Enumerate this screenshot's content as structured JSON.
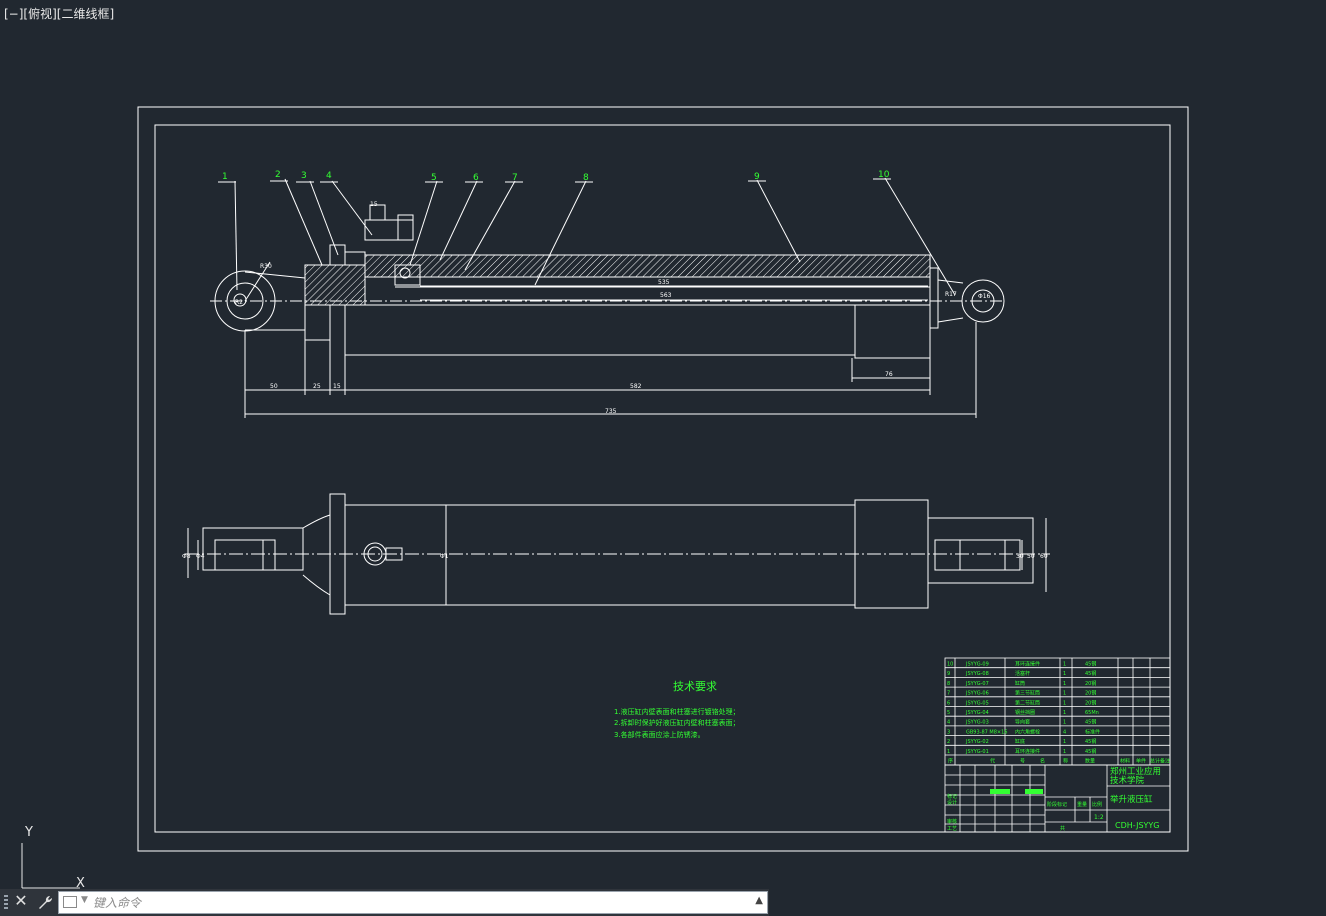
{
  "viewport": {
    "label": "[−][俯视][二维线框]"
  },
  "balloons": [
    "1",
    "2",
    "3",
    "4",
    "5",
    "6",
    "7",
    "8",
    "9",
    "10"
  ],
  "dimensions": {
    "small_top": "15",
    "r1": "R30",
    "r2": "R2",
    "d535": "535",
    "d563": "563",
    "d50": "50",
    "d25": "25",
    "d15": "15",
    "d582": "582",
    "d76": "76",
    "d735": "735",
    "r_right": "R17",
    "d16": "Φ16",
    "lower_left": "Φ8",
    "lower_left2": "Φ4",
    "lower_mid": "Φ1",
    "lower_right1": "30",
    "lower_right2": "50",
    "lower_right3": "60"
  },
  "tech": {
    "title": "技术要求",
    "lines": [
      "1.液压缸内壁表面和柱塞进行镀铬处理；",
      "2.拆卸时保护好液压缸内壁和柱塞表面；",
      "3.各部件表面应涂上防锈漆。"
    ]
  },
  "bom_rows": [
    {
      "no": "10",
      "code": "JSYYG-09",
      "name": "耳环连接件",
      "qty": "1",
      "mat": "45钢"
    },
    {
      "no": "9",
      "code": "JSYYG-08",
      "name": "活塞杆",
      "qty": "1",
      "mat": "45钢"
    },
    {
      "no": "8",
      "code": "JSYYG-07",
      "name": "缸筒",
      "qty": "1",
      "mat": "20钢"
    },
    {
      "no": "7",
      "code": "JSYYG-06",
      "name": "第三节缸筒",
      "qty": "1",
      "mat": "20钢"
    },
    {
      "no": "6",
      "code": "JSYYG-05",
      "name": "第二节缸筒",
      "qty": "1",
      "mat": "20钢"
    },
    {
      "no": "5",
      "code": "JSYYG-04",
      "name": "钢丝挡圈",
      "qty": "1",
      "mat": "65Mn"
    },
    {
      "no": "4",
      "code": "JSYYG-03",
      "name": "导向套",
      "qty": "1",
      "mat": "45钢"
    },
    {
      "no": "3",
      "code": "GB93-87 M8×16",
      "name": "内六角螺栓",
      "qty": "4",
      "mat": "标准件"
    },
    {
      "no": "2",
      "code": "JSYYG-02",
      "name": "缸底",
      "qty": "1",
      "mat": "45钢"
    },
    {
      "no": "1",
      "code": "JSYYG-01",
      "name": "耳环连接件",
      "qty": "1",
      "mat": "45钢"
    }
  ],
  "bom_header": [
    "序",
    "代",
    "号",
    "名",
    "称",
    "数量",
    "材料",
    "单件",
    "总计",
    "备注"
  ],
  "title_block": {
    "school": "郑州工业应用技术学院",
    "drawing_name": "举升液压缸",
    "drawing_code": "CDH-JSYYG",
    "labels": [
      "标记",
      "处数",
      "分区",
      "更改文件号",
      "签名",
      "年月日",
      "设计",
      "标准化",
      "阶段标记",
      "重量",
      "比例",
      "审核",
      "工艺",
      "批准",
      "共",
      "张",
      "第",
      "张"
    ],
    "scale": "1:2"
  },
  "ucs": {
    "y": "Y",
    "x": "X"
  },
  "command": {
    "placeholder": "键入命令",
    "value": ""
  },
  "colors": {
    "background": "#212830",
    "lines": "#ffffff",
    "annotation": "#33ff33",
    "command_bar": "#2f343b"
  },
  "icons": {
    "close": "close-icon",
    "tools": "wrench-icon",
    "prompt": "command-prompt-icon",
    "history": "caret-up-icon"
  }
}
